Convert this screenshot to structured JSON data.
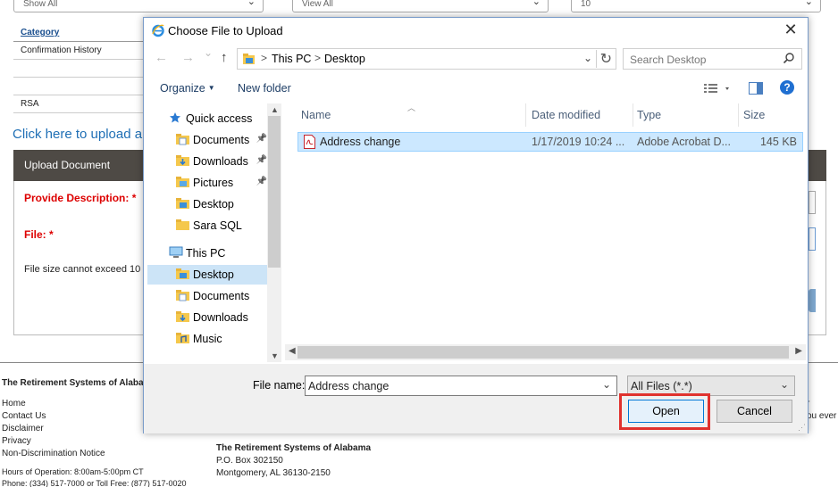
{
  "background_page": {
    "filters": [
      "Show All",
      "View All",
      "10"
    ],
    "table_header": "Category",
    "table_rows": [
      "Confirmation History",
      "",
      "",
      "RSA"
    ],
    "upload_link": "Click here to upload a",
    "upload_bar_title": "Upload Document",
    "description_label": "Provide Description: *",
    "file_label": "File: *",
    "size_note": "File size cannot exceed 10",
    "footer": {
      "title": "The Retirement Systems of Alabam",
      "links": [
        "Home",
        "Contact Us",
        "Disclaimer",
        "Privacy",
        "Non-Discrimination Notice"
      ],
      "hours": [
        "Hours of Operation: 8:00am-5:00pm CT",
        "Phone: (334) 517-7000 or Toll Free: (877) 517-0020"
      ],
      "address": [
        "The Retirement Systems of Alabama",
        "P.O. Box 302150",
        "Montgomery, AL 36130-2150"
      ],
      "right_fragments": [
        "r",
        "ou ever"
      ]
    }
  },
  "dialog": {
    "title": "Choose File to Upload",
    "close_glyph": "✕",
    "nav": {
      "back": "←",
      "forward": "→",
      "recent": "⌄",
      "up": "↑"
    },
    "address": {
      "crumbs": [
        "This PC",
        "Desktop"
      ],
      "separator": ">",
      "dropdown": "⌄",
      "refresh": "↻"
    },
    "search_placeholder": "Search Desktop",
    "toolbar": {
      "organize": "Organize",
      "new_folder": "New folder",
      "help": "?"
    },
    "tree": [
      {
        "label": "Quick access",
        "icon": "star-icon",
        "pinned": false,
        "selected": false
      },
      {
        "label": "Documents",
        "icon": "documents-folder-icon",
        "pinned": true,
        "selected": false
      },
      {
        "label": "Downloads",
        "icon": "downloads-folder-icon",
        "pinned": true,
        "selected": false
      },
      {
        "label": "Pictures",
        "icon": "pictures-folder-icon",
        "pinned": true,
        "selected": false
      },
      {
        "label": "Desktop",
        "icon": "desktop-folder-icon",
        "pinned": false,
        "selected": false
      },
      {
        "label": "Sara SQL",
        "icon": "folder-icon",
        "pinned": false,
        "selected": false
      },
      {
        "label": "This PC",
        "icon": "computer-icon",
        "pinned": false,
        "selected": false
      },
      {
        "label": "Desktop",
        "icon": "desktop-folder-icon",
        "pinned": false,
        "selected": true
      },
      {
        "label": "Documents",
        "icon": "documents-folder-icon",
        "pinned": false,
        "selected": false
      },
      {
        "label": "Downloads",
        "icon": "downloads-folder-icon",
        "pinned": false,
        "selected": false
      },
      {
        "label": "Music",
        "icon": "music-folder-icon",
        "pinned": false,
        "selected": false
      }
    ],
    "columns": [
      "Name",
      "Date modified",
      "Type",
      "Size"
    ],
    "files": [
      {
        "name": "Address change",
        "date": "1/17/2019 10:24 ...",
        "type": "Adobe Acrobat D...",
        "size": "145 KB",
        "icon": "pdf-icon",
        "selected": true
      }
    ],
    "file_name_label": "File name:",
    "file_name_value": "Address change",
    "file_type": "All Files (*.*)",
    "open_button": "Open",
    "cancel_button": "Cancel",
    "colors": {
      "selection": "#cce4f7",
      "accent": "#0078d7",
      "callout": "#e0322e"
    }
  }
}
